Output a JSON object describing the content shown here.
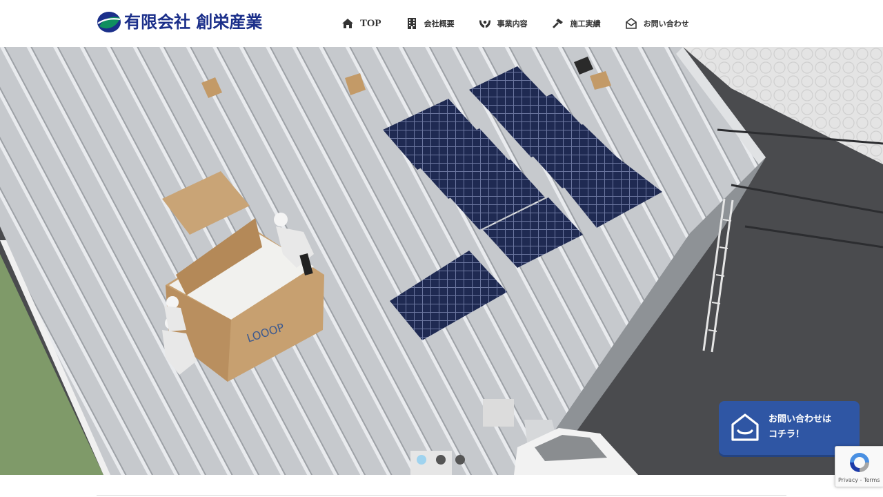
{
  "header": {
    "logo_text": "有限会社 創栄産業",
    "nav": [
      {
        "label": "TOP",
        "icon": "home-icon"
      },
      {
        "label": "会社概要",
        "icon": "building-icon"
      },
      {
        "label": "事業内容",
        "icon": "handshake-icon"
      },
      {
        "label": "施工実績",
        "icon": "hammer-icon"
      },
      {
        "label": "お問い合わせ",
        "icon": "envelope-open-icon"
      }
    ]
  },
  "hero": {
    "slides": 3,
    "active_slide": 1,
    "box_print": "LOOOP"
  },
  "cta": {
    "line1": "お問い合わせは",
    "line2": "コチラ！"
  },
  "recaptcha": {
    "links": "Privacy - Terms"
  },
  "colors": {
    "brand_blue": "#1b2f8a",
    "brand_green": "#0f8f5f",
    "cta_blue": "#2f56a4",
    "dot_active": "#9fd3ef"
  }
}
